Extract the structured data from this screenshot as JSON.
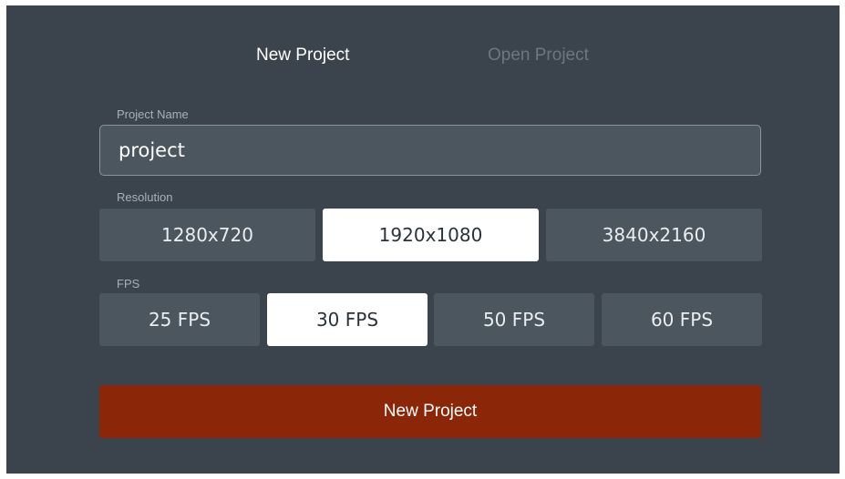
{
  "tabs": {
    "new_project": "New Project",
    "open_project": "Open Project",
    "active": "new_project"
  },
  "project_name": {
    "label": "Project Name",
    "value": "project"
  },
  "resolution": {
    "label": "Resolution",
    "options": [
      "1280x720",
      "1920x1080",
      "3840x2160"
    ],
    "selected": "1920x1080"
  },
  "fps": {
    "label": "FPS",
    "options": [
      "25 FPS",
      "30 FPS",
      "50 FPS",
      "60 FPS"
    ],
    "selected": "30 FPS"
  },
  "submit": {
    "label": "New Project"
  },
  "colors": {
    "background": "#3b444c",
    "option": "#4b565f",
    "selected": "#ffffff",
    "accent": "#8b2608"
  }
}
